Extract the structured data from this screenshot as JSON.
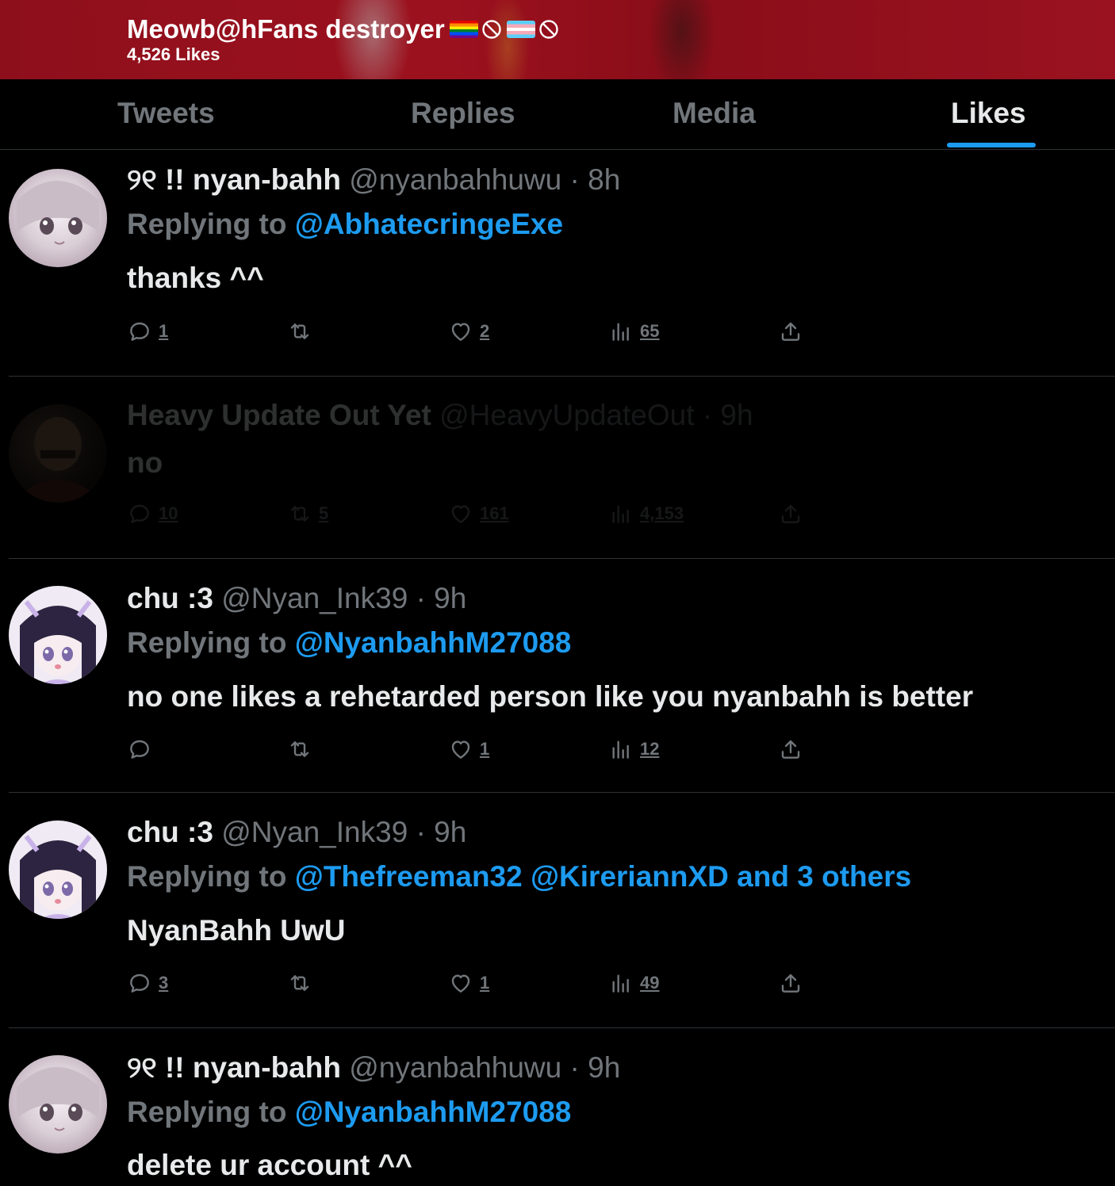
{
  "header": {
    "name": "Meowb@hFans destroyer",
    "likes_count": "4,526 Likes",
    "emoji_icons": [
      "rainbow-flag-icon",
      "prohibited-icon",
      "trans-flag-icon",
      "prohibited-icon"
    ]
  },
  "tabs": [
    {
      "label": "Tweets",
      "active": false
    },
    {
      "label": "Replies",
      "active": false
    },
    {
      "label": "Media",
      "active": false
    },
    {
      "label": "Likes",
      "active": true
    }
  ],
  "colors": {
    "accent": "#1d9bf0",
    "header_bg": "#9c111e",
    "muted_text": "#71767b",
    "background": "#000000"
  },
  "tweets": [
    {
      "name": "୨୧ !! nyan-bahh",
      "handle": "@nyanbahhuwu",
      "time": "· 8h",
      "replying_label": "Replying to",
      "replying_to": "@AbhatecringeExe",
      "text": "thanks ^^",
      "replies": "1",
      "retweets": "",
      "likes": "2",
      "views": "65",
      "dimmed": false
    },
    {
      "name": "Heavy Update Out Yet",
      "handle": "@HeavyUpdateOut",
      "time": "· 9h",
      "text": "no",
      "replies": "10",
      "retweets": "5",
      "likes": "161",
      "views": "4,153",
      "dimmed": true
    },
    {
      "name": "chu :3",
      "handle": "@Nyan_Ink39",
      "time": "· 9h",
      "replying_label": "Replying to",
      "replying_to": "@NyanbahhM27088",
      "text": "no one likes a rehetarded person like you nyanbahh is better",
      "replies": "",
      "retweets": "",
      "likes": "1",
      "views": "12",
      "dimmed": false
    },
    {
      "name": "chu :3",
      "handle": "@Nyan_Ink39",
      "time": "· 9h",
      "replying_label": "Replying to",
      "replying_to": "@Thefreeman32 @KireriannXD and 3 others",
      "text": "NyanBahh UwU",
      "replies": "3",
      "retweets": "",
      "likes": "1",
      "views": "49",
      "dimmed": false
    },
    {
      "name": "୨୧ !! nyan-bahh",
      "handle": "@nyanbahhuwu",
      "time": "· 9h",
      "replying_label": "Replying to",
      "replying_to": "@NyanbahhM27088",
      "text": "delete ur account ^^",
      "dimmed": false
    }
  ]
}
